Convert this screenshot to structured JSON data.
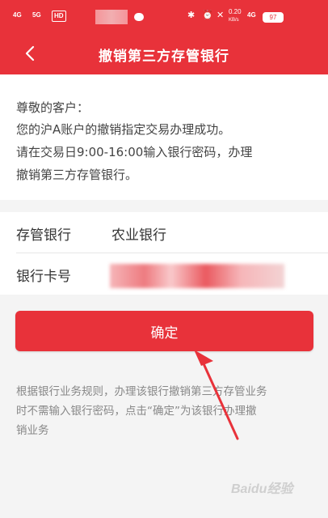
{
  "status_bar": {
    "network1": "4G",
    "network2": "5G",
    "hd_badge": "HD",
    "speed": "0.20",
    "speed_unit": "KB/s",
    "network3": "4G",
    "battery": "97"
  },
  "header": {
    "title": "撤销第三方存管银行"
  },
  "notice": {
    "lines": [
      "尊敬的客户：",
      "您的沪A账户的撤销指定交易办理成功。",
      "请在交易日9:00-16:00输入银行密码，办理",
      "撤销第三方存管银行。"
    ]
  },
  "info": {
    "bank_label": "存管银行",
    "bank_value": "农业银行",
    "card_label": "银行卡号"
  },
  "actions": {
    "confirm_label": "确定"
  },
  "footnote": {
    "lines": [
      "根据银行业务规则，办理该银行撤销第三方存管业务",
      "时不需输入银行密码，点击“确定”为该银行办理撤",
      "销业务"
    ]
  },
  "watermark": "Baidu经验",
  "colors": {
    "brand_red": "#e8323a",
    "background": "#f4f4f4"
  },
  "icons": {
    "back": "chevron-left-icon"
  }
}
